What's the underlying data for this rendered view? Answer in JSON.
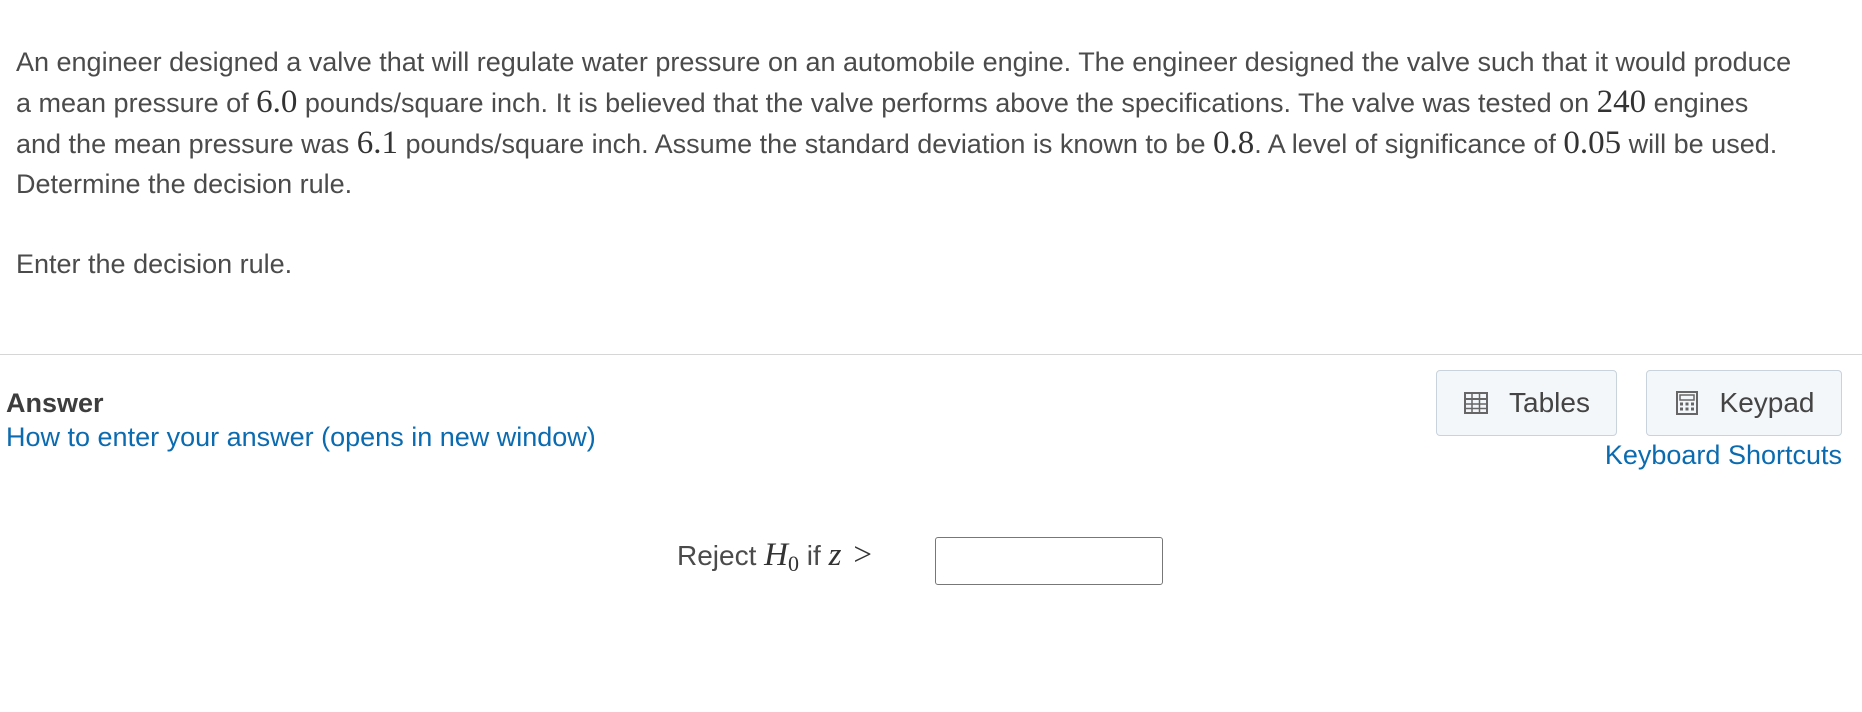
{
  "question": {
    "t1": "An engineer designed a valve that will regulate water pressure on an automobile engine.  The engineer designed the valve such that it would produce a mean pressure of ",
    "mean": "6.0",
    "t2": " pounds/square inch.  It is believed that the valve performs above the specifications.  The valve was tested on ",
    "n": "240",
    "t3": " engines and the mean pressure was ",
    "sample_mean": "6.1",
    "t4": " pounds/square inch.  Assume the standard deviation is known to be ",
    "sd": "0.8",
    "t5": ".  A level of significance of ",
    "alpha": "0.05",
    "t6": " will be used.  Determine the decision rule."
  },
  "prompt": "Enter the decision rule.",
  "answer": {
    "label": "Answer",
    "how_link": "How to enter your answer (opens in new window)"
  },
  "tools": {
    "tables_label": "Tables",
    "tables_icon": "table-icon",
    "keypad_label": "Keypad",
    "keypad_icon": "calculator-icon",
    "shortcuts_label": "Keyboard Shortcuts"
  },
  "rule": {
    "prefix": "Reject ",
    "h": "H",
    "h_sub": "0",
    "mid": " if ",
    "z": "z",
    "gt": ">",
    "input_value": ""
  },
  "colors": {
    "link": "#0b6bb0",
    "text": "#4b4b4b",
    "button_bg": "#f4f7f9",
    "button_border": "#c9d3dc"
  }
}
